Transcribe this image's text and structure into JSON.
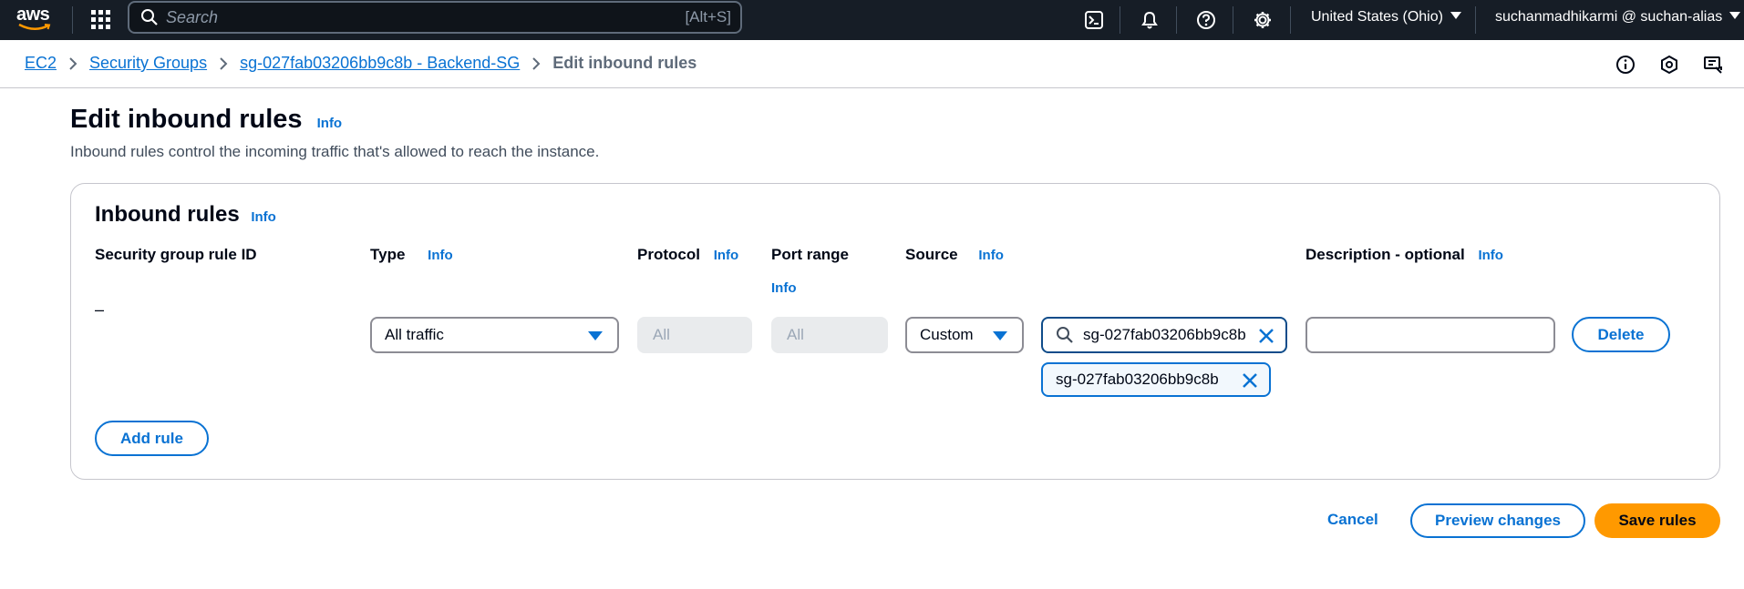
{
  "topnav": {
    "logo": "aws",
    "search_placeholder": "Search",
    "search_shortcut": "[Alt+S]",
    "icons": [
      "cloudshell-icon",
      "bell-icon",
      "help-icon",
      "gear-icon"
    ],
    "region": "United States (Ohio)",
    "account": "suchanmadhikarmi @ suchan-alias"
  },
  "breadcrumb": {
    "items": [
      "EC2",
      "Security Groups",
      "sg-027fab03206bb9c8b - Backend-SG"
    ],
    "current": "Edit inbound rules"
  },
  "page": {
    "title": "Edit inbound rules",
    "info": "Info",
    "description": "Inbound rules control the incoming traffic that's allowed to reach the instance."
  },
  "inbound_rules": {
    "title": "Inbound rules",
    "info": "Info",
    "columns": {
      "rule_id": "Security group rule ID",
      "type": "Type",
      "protocol": "Protocol",
      "port_range": "Port range",
      "source": "Source",
      "description": "Description - optional"
    },
    "rule": {
      "rule_id": "–",
      "type": "All traffic",
      "protocol": "All",
      "port_range": "All",
      "source_type": "Custom",
      "source_search_value": "sg-027fab03206bb9c8b",
      "source_token": "sg-027fab03206bb9c8b",
      "description": "",
      "delete_label": "Delete"
    },
    "add_rule_label": "Add rule"
  },
  "footer": {
    "cancel": "Cancel",
    "preview": "Preview changes",
    "save": "Save rules"
  },
  "colors": {
    "nav_bg": "#161d26",
    "link": "#0972d3",
    "primary": "#ff9900"
  }
}
